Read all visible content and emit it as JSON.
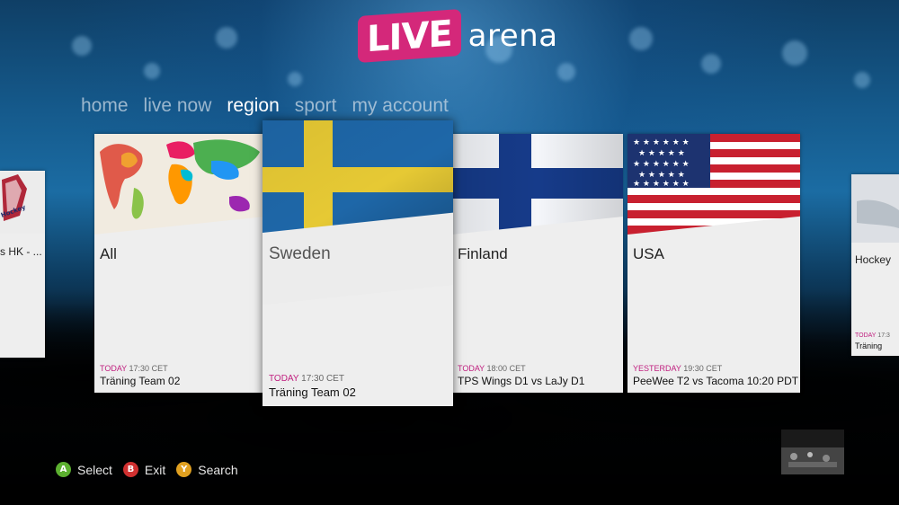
{
  "app": {
    "logo_live": "LIVE",
    "logo_arena": "arena"
  },
  "nav": [
    {
      "label": "home",
      "active": false
    },
    {
      "label": "live now",
      "active": false
    },
    {
      "label": "region",
      "active": true
    },
    {
      "label": "sport",
      "active": false
    },
    {
      "label": "my account",
      "active": false
    }
  ],
  "left_partial_card": {
    "label": "s HK  - ...",
    "crest_text": "Hockey"
  },
  "cards": [
    {
      "title": "All",
      "day": "TODAY",
      "time": "17:30",
      "tz": "CET",
      "event": "Träning Team 02",
      "flag": "world-map-icon"
    },
    {
      "title": "Sweden",
      "day": "TODAY",
      "time": "17:30",
      "tz": "CET",
      "event": "Träning Team 02",
      "flag": "sweden-flag-icon"
    },
    {
      "title": "Finland",
      "day": "TODAY",
      "time": "18:00",
      "tz": "CET",
      "event": "TPS Wings D1 vs LaJy D1",
      "flag": "finland-flag-icon"
    },
    {
      "title": "USA",
      "day": "YESTERDAY",
      "time": "19:30",
      "tz": "CET",
      "event": "PeeWee T2 vs Tacoma 10:20 PDT",
      "flag": "usa-flag-icon"
    }
  ],
  "right_partial_card": {
    "title": "Hockey",
    "day": "TODAY",
    "time": "17:3",
    "event": "Träning"
  },
  "controls": [
    {
      "key": "A",
      "label": "Select",
      "color": "#5cb030"
    },
    {
      "key": "B",
      "label": "Exit",
      "color": "#d03030"
    },
    {
      "key": "Y",
      "label": "Search",
      "color": "#e0a020"
    }
  ],
  "colors": {
    "accent": "#d4287a",
    "day_label": "#c01f7f"
  }
}
